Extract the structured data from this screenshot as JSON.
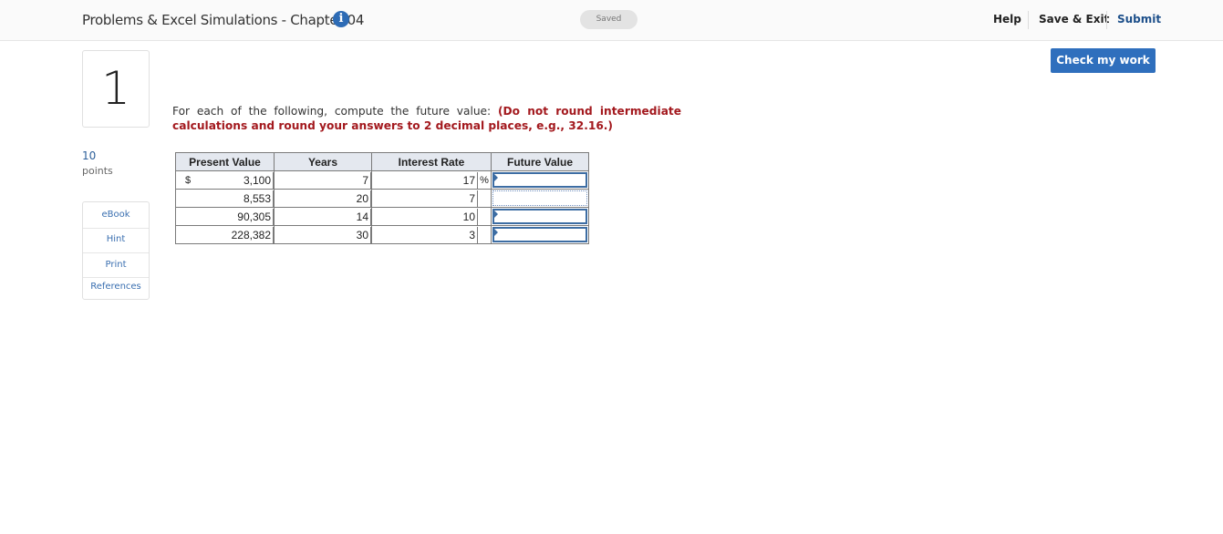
{
  "header": {
    "title": "Problems & Excel Simulations - Chapter 04",
    "info_icon": "info-circle-icon",
    "saved_label": "Saved",
    "help_label": "Help",
    "save_exit_label": "Save & Exit",
    "submit_label": "Submit",
    "accent": "#2f6fbd"
  },
  "question": {
    "number": "1",
    "points_value": "10",
    "points_label": "points",
    "check_label": "Check my work",
    "instruction_plain": "For each of the following, compute the future value:",
    "instruction_bold": "(Do not round intermediate calculations and round your answers to 2 decimal places, e.g., 32.16.)",
    "instruction_color": "#a3191e"
  },
  "tools": {
    "ebook": "eBook",
    "hint": "Hint",
    "print": "Print",
    "references": "References"
  },
  "table": {
    "headers": [
      "Present Value",
      "Years",
      "Interest Rate",
      "Future Value"
    ],
    "currency_symbol": "$",
    "percent_symbol": "%",
    "rows": [
      {
        "pv": "3,100",
        "years": "7",
        "rate": "17",
        "fv": ""
      },
      {
        "pv": "8,553",
        "years": "20",
        "rate": "7",
        "fv": ""
      },
      {
        "pv": "90,305",
        "years": "14",
        "rate": "10",
        "fv": ""
      },
      {
        "pv": "228,382",
        "years": "30",
        "rate": "3",
        "fv": ""
      }
    ]
  }
}
